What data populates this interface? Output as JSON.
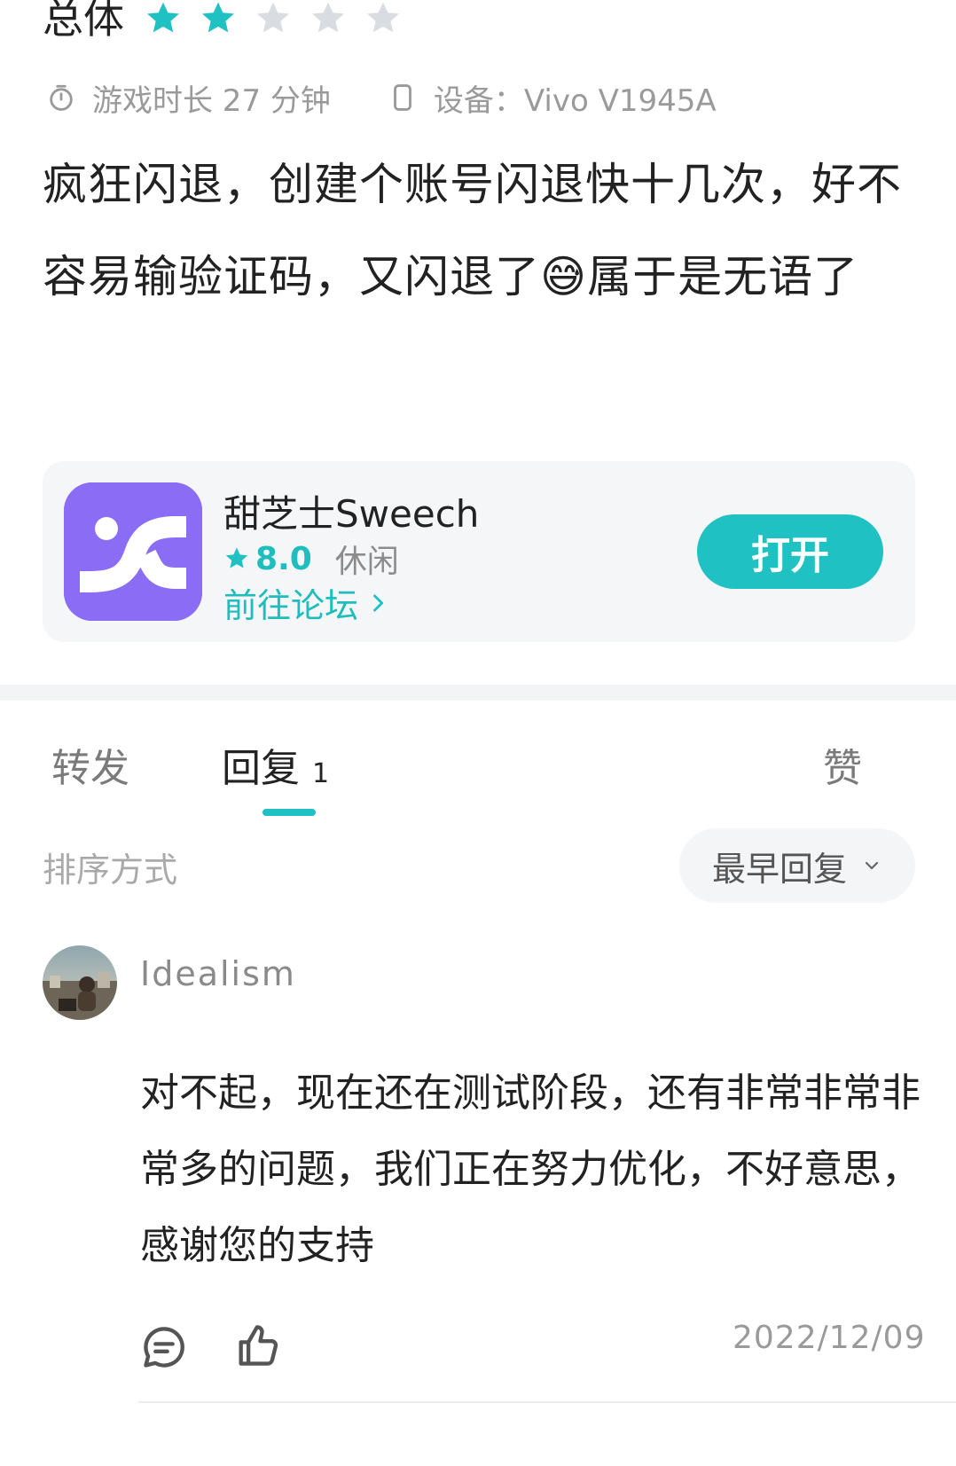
{
  "review": {
    "rating_label": "总体",
    "rating": {
      "value": 2,
      "max": 5
    },
    "play_time_text": "游戏时长 27 分钟",
    "device_text": "设备：Vivo V1945A",
    "text": "疯狂闪退，创建个账号闪退快十几次，好不容易输验证码，又闪退了😅属于是无语了"
  },
  "app_card": {
    "name": "甜芝士Sweech",
    "score": "8.0",
    "genre": "休闲",
    "forum_link": "前往论坛",
    "open_label": "打开",
    "icon_color": "#8a6cf5"
  },
  "tabs": [
    {
      "label": "转发",
      "count": ""
    },
    {
      "label": "回复",
      "count": "1",
      "active": true
    },
    {
      "label": "赞",
      "count": ""
    }
  ],
  "sort": {
    "label": "排序方式",
    "selected": "最早回复"
  },
  "reply": {
    "username": "Idealism",
    "text": "对不起，现在还在测试阶段，还有非常非常非常多的问题，我们正在努力优化，不好意思，感谢您的支持",
    "date": "2022/12/09"
  },
  "colors": {
    "accent": "#1fc1c3",
    "star_off": "#d9dde1",
    "muted_text": "#9a9a9a"
  }
}
